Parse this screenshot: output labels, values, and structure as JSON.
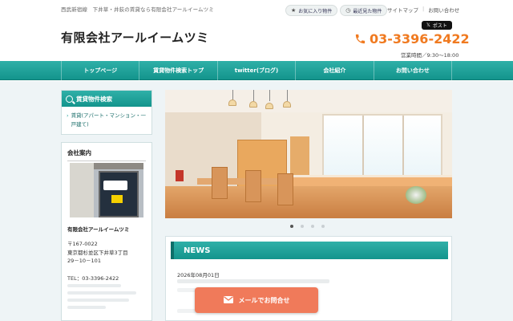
{
  "header": {
    "tagline": "西武新宿線　下井草・井荻の賃貸なら有限会社アールイームツミ",
    "favorites_label": "お気に入り物件",
    "recent_label": "最近見た物件",
    "sitemap_label": "サイトマップ",
    "contact_link_label": "お問い合わせ",
    "logo_text": "有限会社アールイームツミ",
    "x_post_label": "ポスト",
    "phone": "03-3396-2422",
    "hours": "営業時間／9:30〜18:00"
  },
  "global_nav": {
    "items": [
      {
        "label": "トップページ"
      },
      {
        "label": "賃貸物件検索トップ"
      },
      {
        "label": "twitter(ブログ)"
      },
      {
        "label": "会社紹介"
      },
      {
        "label": "お問い合わせ"
      }
    ]
  },
  "sidebar": {
    "search_heading": "賃貸物件検索",
    "search_link": "賃貸(アパート・マンション・一戸建て)",
    "company_heading": "会社案内",
    "company_name": "有限会社アールイームツミ",
    "postal": "〒167-0022",
    "address_line1": "東京都杉並区下井草3丁目",
    "address_line2": "29－10－101",
    "tel": "TEL：03-3396-2422"
  },
  "slider": {
    "dots": 4,
    "active_index": 0
  },
  "news": {
    "heading": "NEWS",
    "date": "2026年08月01日"
  },
  "floating": {
    "mail_button_label": "メールでお問合せ"
  },
  "colors": {
    "accent": "#1aa39b",
    "phone": "#f07a20",
    "mail_button": "#f07a5a"
  }
}
